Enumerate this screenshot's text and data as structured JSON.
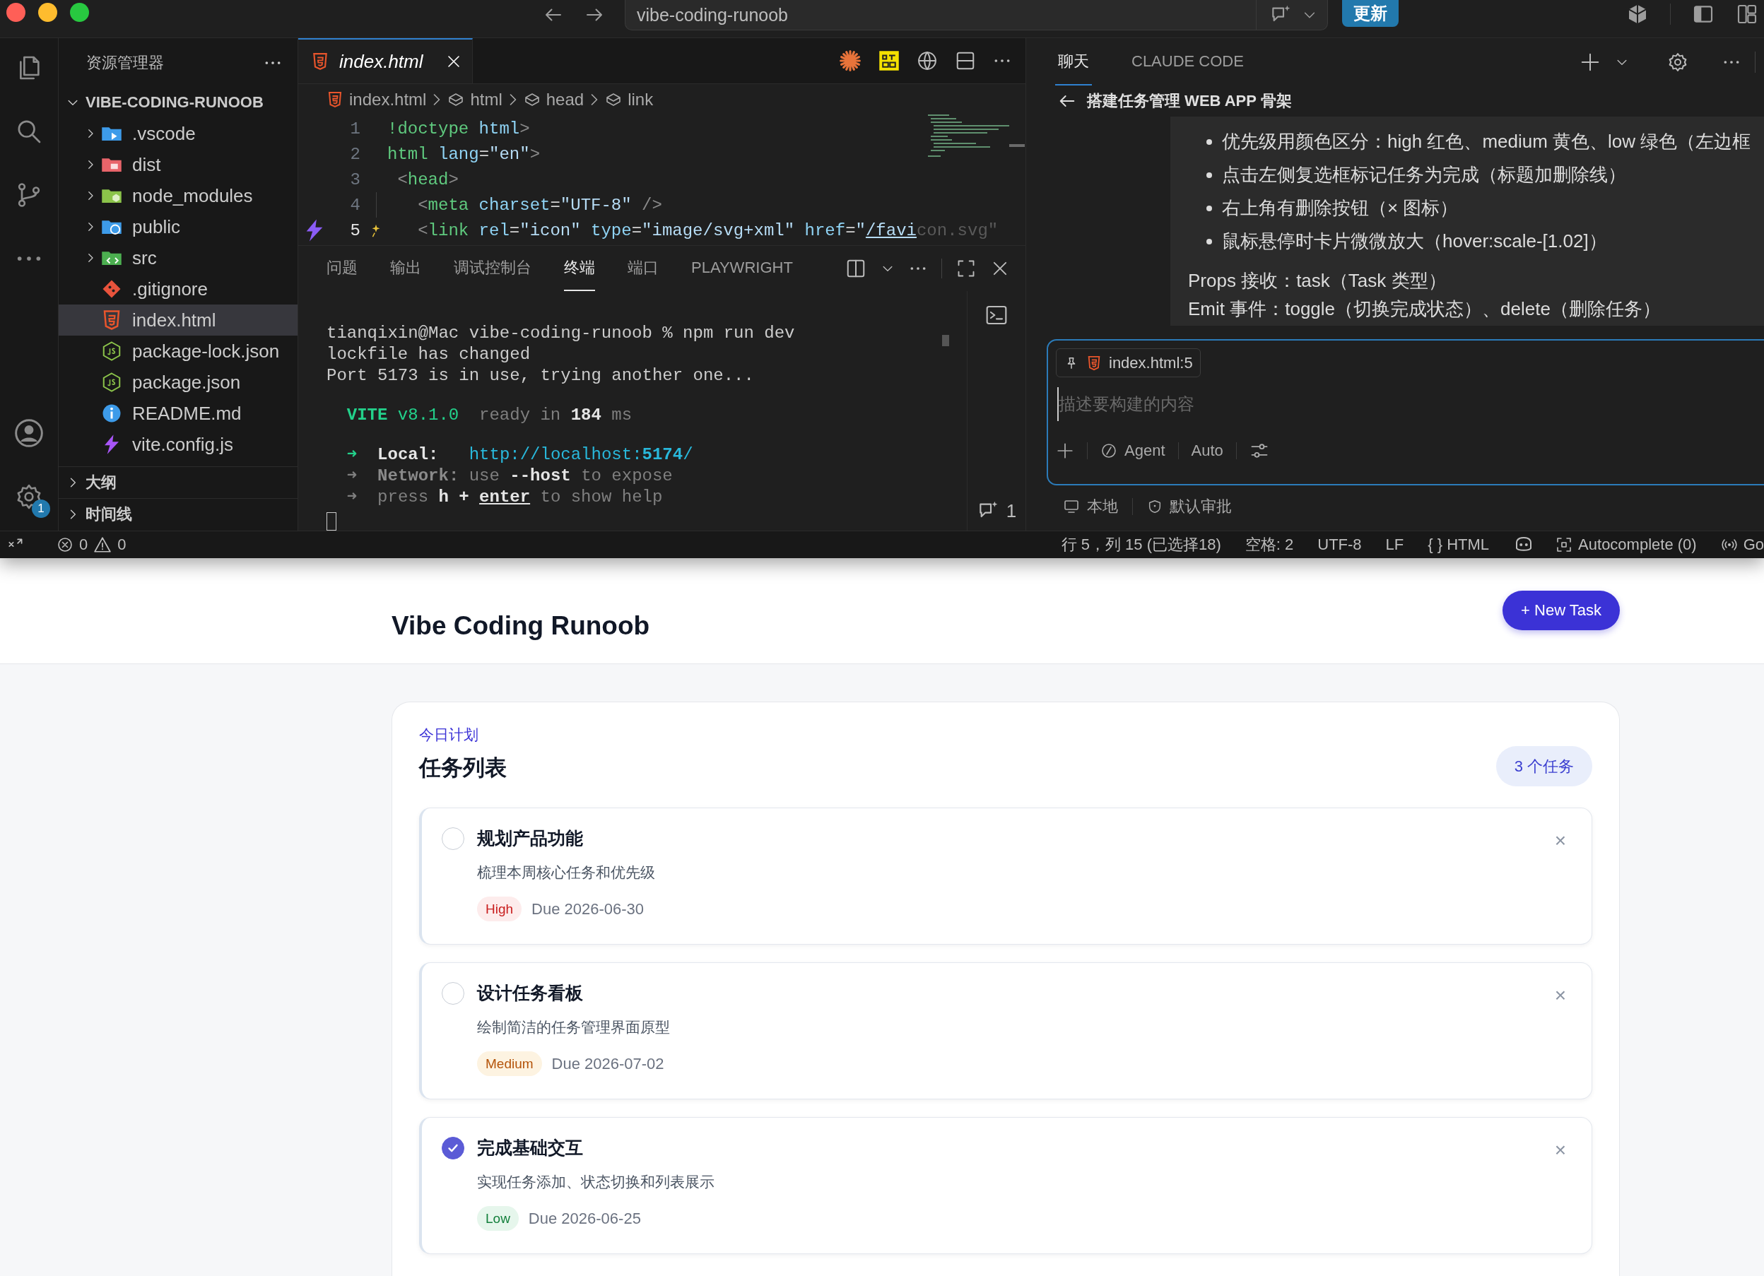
{
  "window": {
    "title": "vibe-coding-runoob",
    "update_button": "更新"
  },
  "activity_bar": {
    "settings_badge": "1"
  },
  "explorer": {
    "title": "资源管理器",
    "root": {
      "label": "VIBE-CODING-RUNOOB",
      "expanded": true
    },
    "items": [
      {
        "name": ".vscode",
        "kind": "folder",
        "expanded": false,
        "selected": false
      },
      {
        "name": "dist",
        "kind": "folder",
        "expanded": false,
        "selected": false
      },
      {
        "name": "node_modules",
        "kind": "folder",
        "expanded": false,
        "selected": false
      },
      {
        "name": "public",
        "kind": "folder",
        "expanded": false,
        "selected": false
      },
      {
        "name": "src",
        "kind": "folder",
        "expanded": false,
        "selected": false
      },
      {
        "name": ".gitignore",
        "kind": "file",
        "selected": false
      },
      {
        "name": "index.html",
        "kind": "file",
        "selected": true
      },
      {
        "name": "package-lock.json",
        "kind": "file",
        "selected": false
      },
      {
        "name": "package.json",
        "kind": "file",
        "selected": false
      },
      {
        "name": "README.md",
        "kind": "file",
        "selected": false
      },
      {
        "name": "vite.config.js",
        "kind": "file",
        "selected": false
      }
    ],
    "sections": [
      {
        "label": "大纲",
        "expanded": false
      },
      {
        "label": "时间线",
        "expanded": false
      }
    ]
  },
  "editor": {
    "tab": {
      "label": "index.html",
      "selected": true
    },
    "breadcrumb": [
      "index.html",
      "html",
      "head",
      "link"
    ],
    "lines": [
      {
        "number": "1",
        "current": false,
        "tokens": [
          {
            "kind": "tag",
            "text": "!doctype"
          },
          {
            "kind": "attr",
            "text": " html"
          },
          {
            "kind": "punct",
            "text": ">"
          }
        ]
      },
      {
        "number": "2",
        "current": false,
        "tokens": [
          {
            "kind": "tag",
            "text": "html"
          },
          {
            "kind": "attr",
            "text": " lang"
          },
          {
            "kind": "plain",
            "text": "="
          },
          {
            "kind": "string",
            "text": "\"en\""
          },
          {
            "kind": "punct",
            "text": ">"
          }
        ]
      },
      {
        "number": "3",
        "current": false,
        "tokens": [
          {
            "kind": "punct",
            "text": " <"
          },
          {
            "kind": "tag",
            "text": "head"
          },
          {
            "kind": "punct",
            "text": ">"
          }
        ]
      },
      {
        "number": "4",
        "current": false,
        "tokens": [
          {
            "kind": "punct",
            "text": "   <"
          },
          {
            "kind": "tag",
            "text": "meta"
          },
          {
            "kind": "attr",
            "text": " charset"
          },
          {
            "kind": "plain",
            "text": "="
          },
          {
            "kind": "string",
            "text": "\"UTF-8\""
          },
          {
            "kind": "punct",
            "text": " />"
          }
        ]
      },
      {
        "number": "5",
        "current": true,
        "tokens": [
          {
            "kind": "punct",
            "text": "   <"
          },
          {
            "kind": "tag",
            "text": "link"
          },
          {
            "kind": "attr",
            "text": " rel"
          },
          {
            "kind": "plain",
            "text": "="
          },
          {
            "kind": "string",
            "text": "\"icon\""
          },
          {
            "kind": "attr",
            "text": " type"
          },
          {
            "kind": "plain",
            "text": "="
          },
          {
            "kind": "string",
            "text": "\"image/svg+xml\""
          },
          {
            "kind": "attr",
            "text": " href"
          },
          {
            "kind": "plain",
            "text": "="
          },
          {
            "kind": "string",
            "text": "\""
          },
          {
            "kind": "link",
            "text": "/favi"
          },
          {
            "kind": "ghost",
            "text": "con.svg\""
          }
        ]
      }
    ]
  },
  "panel": {
    "tabs": [
      {
        "label": "问题",
        "selected": false
      },
      {
        "label": "输出",
        "selected": false
      },
      {
        "label": "调试控制台",
        "selected": false
      },
      {
        "label": "终端",
        "selected": true
      },
      {
        "label": "端口",
        "selected": false
      },
      {
        "label": "PLAYWRIGHT",
        "selected": false
      }
    ],
    "terminal": [
      {
        "lines": [
          {
            "tokens": [
              {
                "kind": "plain",
                "text": "tianqixin@Mac vibe-coding-runoob % npm run dev"
              }
            ]
          },
          {
            "tokens": [
              {
                "kind": "plain",
                "text": "lockfile has changed"
              }
            ]
          },
          {
            "tokens": [
              {
                "kind": "plain",
                "text": "Port 5173 is in use, trying another one..."
              }
            ]
          }
        ]
      },
      {
        "lines": [
          {
            "tokens": [
              {
                "kind": "green-bold",
                "text": "  VITE"
              },
              {
                "kind": "green",
                "text": " v8.1.0"
              },
              {
                "kind": "dim",
                "text": "  ready in "
              },
              {
                "kind": "bold",
                "text": "184"
              },
              {
                "kind": "dim",
                "text": " ms"
              }
            ]
          }
        ]
      },
      {
        "lines": [
          {
            "tokens": [
              {
                "kind": "green",
                "text": "  ➜"
              },
              {
                "kind": "bold",
                "text": "  Local:"
              },
              {
                "kind": "cyan",
                "text": "   http://localhost:"
              },
              {
                "kind": "cyan-bold",
                "text": "5174"
              },
              {
                "kind": "cyan",
                "text": "/"
              }
            ]
          },
          {
            "tokens": [
              {
                "kind": "dim",
                "text": "  ➜"
              },
              {
                "kind": "dim-bold",
                "text": "  Network:"
              },
              {
                "kind": "dim",
                "text": " use "
              },
              {
                "kind": "bold",
                "text": "--host"
              },
              {
                "kind": "dim",
                "text": " to expose"
              }
            ]
          },
          {
            "tokens": [
              {
                "kind": "dim",
                "text": "  ➜"
              },
              {
                "kind": "dim",
                "text": "  press "
              },
              {
                "kind": "bold",
                "text": "h + "
              },
              {
                "kind": "bold-underline",
                "text": "enter"
              },
              {
                "kind": "dim",
                "text": " to show help"
              }
            ]
          }
        ]
      }
    ],
    "chat_count": "1"
  },
  "chat": {
    "tabs": [
      {
        "label": "聊天",
        "selected": true
      },
      {
        "label": "CLAUDE CODE",
        "selected": false
      }
    ],
    "title": "搭建任务管理 WEB APP 骨架",
    "bullets": [
      "优先级用颜色区分：high 红色、medium 黄色、low 绿色（左边框",
      "点击左侧复选框标记任务为完成（标题加删除线）",
      "右上角有删除按钮（× 图标）",
      "鼠标悬停时卡片微微放大（hover:scale-[1.02]）"
    ],
    "lines": [
      "Props 接收：task（Task 类型）",
      "Emit 事件：toggle（切换完成状态）、delete（删除任务）"
    ],
    "input": {
      "context": "index.html:5",
      "placeholder": "描述要构建的内容",
      "mode": "Agent",
      "model": "Auto"
    },
    "footer": [
      "本地",
      "默认审批"
    ]
  },
  "status_bar": {
    "errors": "0",
    "warnings": "0",
    "items": [
      "行 5，列 15 (已选择18)",
      "空格: 2",
      "UTF-8",
      "LF",
      "{ } HTML"
    ],
    "autocomplete": "Autocomplete (0)",
    "go": "Go"
  },
  "app": {
    "title": "Vibe Coding Runoob",
    "new_button": "+ New Task",
    "section": {
      "eyebrow": "今日计划",
      "title": "任务列表",
      "count": "3 个任务"
    },
    "tasks": [
      {
        "title": "规划产品功能",
        "description": "梳理本周核心任务和优先级",
        "kind": "high",
        "priority_label": "High",
        "due": "Due 2026-06-30",
        "done": false,
        "delete": "×"
      },
      {
        "title": "设计任务看板",
        "description": "绘制简洁的任务管理界面原型",
        "kind": "medium",
        "priority_label": "Medium",
        "due": "Due 2026-07-02",
        "done": false,
        "delete": "×"
      },
      {
        "title": "完成基础交互",
        "description": "实现任务添加、状态切换和列表展示",
        "kind": "low",
        "priority_label": "Low",
        "due": "Due 2026-06-25",
        "done": true,
        "delete": "×"
      }
    ]
  }
}
